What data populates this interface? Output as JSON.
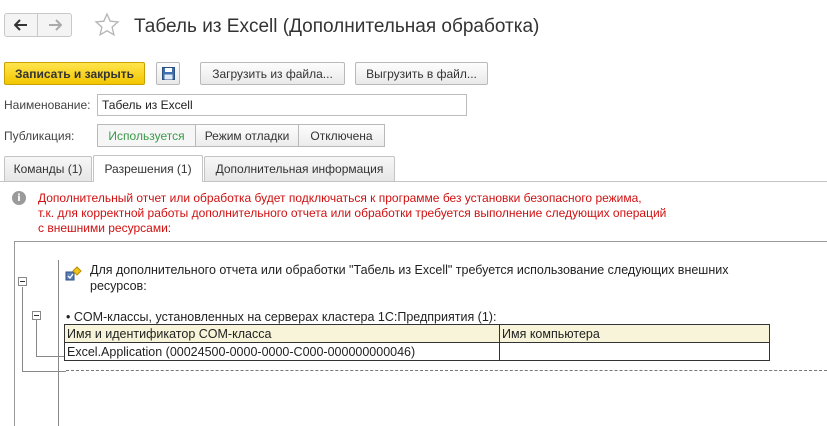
{
  "header": {
    "title": "Табель из Excell (Дополнительная обработка)"
  },
  "toolbar": {
    "save_close_label": "Записать и закрыть",
    "load_label": "Загрузить из файла...",
    "unload_label": "Выгрузить в файл..."
  },
  "form": {
    "name_label": "Наименование:",
    "name_value": "Табель из Excell",
    "publication_label": "Публикация:",
    "publication_options": [
      "Используется",
      "Режим отладки",
      "Отключена"
    ],
    "publication_selected": "Используется"
  },
  "tabs": [
    {
      "label": "Команды (1)"
    },
    {
      "label": "Разрешения (1)",
      "active": true
    },
    {
      "label": "Дополнительная информация"
    }
  ],
  "warning": {
    "lines": [
      "Дополнительный отчет или обработка будет подключаться к программе без установки безопасного режима,",
      "т.к. для корректной работы дополнительного отчета или обработки требуется выполнение следующих операций",
      "с внешними ресурсами:"
    ]
  },
  "permissions": {
    "intro_line1": "Для дополнительного отчета или обработки \"Табель из Excell\" требуется использование следующих внешних",
    "intro_line2": "ресурсов:",
    "section_title": "• COM-классы, установленных на серверах кластера 1С:Предприятия (1):",
    "table": {
      "headers": [
        "Имя и идентификатор COM-класса",
        "Имя компьютера"
      ],
      "rows": [
        [
          "Excel.Application (00024500-0000-0000-C000-000000000046)",
          ""
        ]
      ]
    }
  },
  "colors": {
    "primary_button": "#f2c600",
    "active_option": "#3a9a4a",
    "warning_text": "#d01010",
    "table_header": "#f7f4d9"
  }
}
